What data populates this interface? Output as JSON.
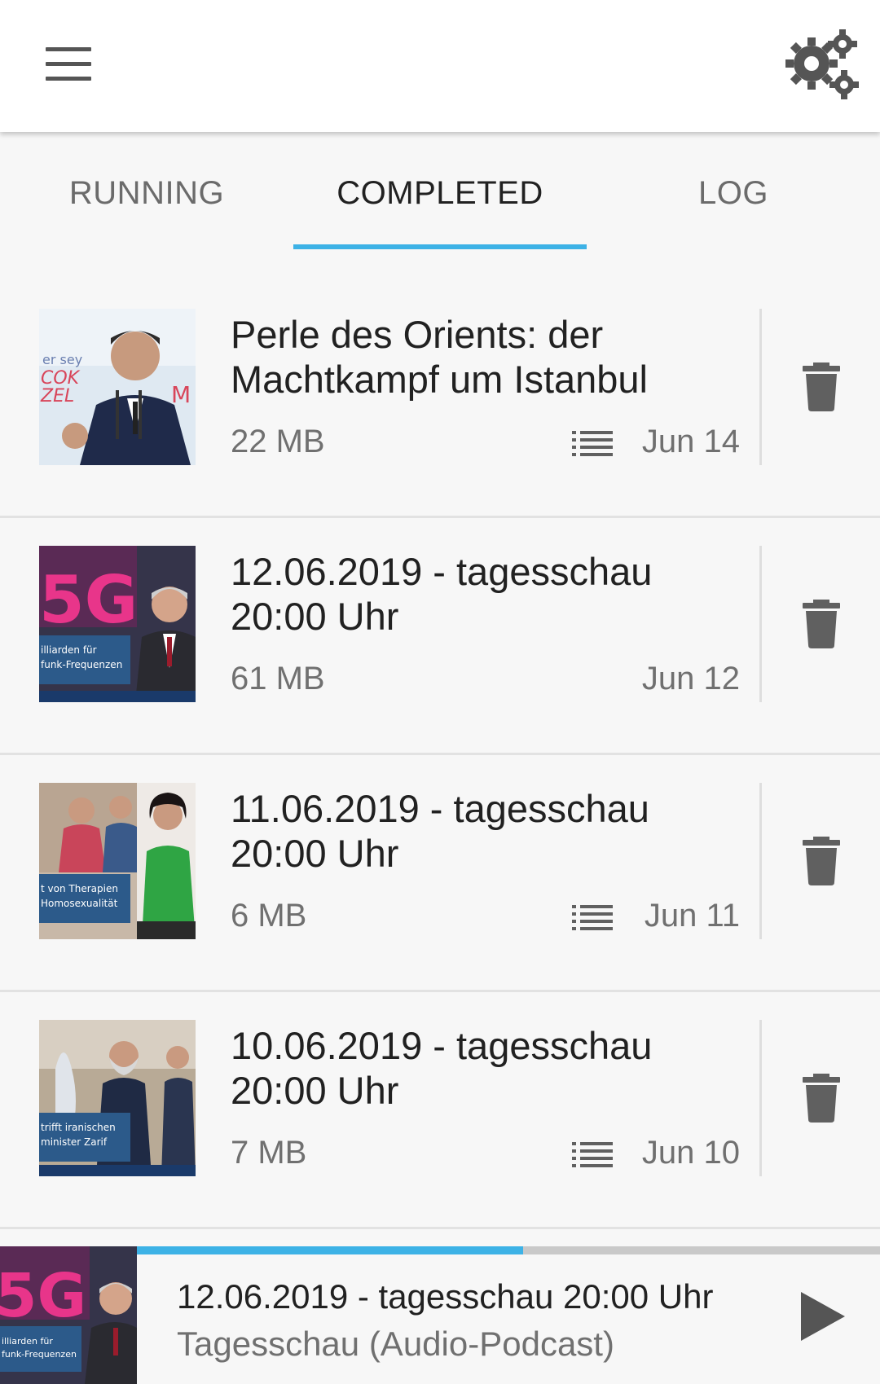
{
  "appbar": {
    "menu_icon": "hamburger-menu-icon",
    "settings_icon": "gears-icon"
  },
  "tabs": [
    {
      "label": "RUNNING",
      "active": false
    },
    {
      "label": "COMPLETED",
      "active": true
    },
    {
      "label": "LOG",
      "active": false
    }
  ],
  "colors": {
    "accent": "#3db2e6",
    "text": "#212121",
    "secondary": "#707070",
    "icon": "#555555"
  },
  "items": [
    {
      "title": "Perle des Orients: der Machtkampf um Istanbul",
      "size": "22 MB",
      "date": "Jun 14",
      "has_chapters": true
    },
    {
      "title": "12.06.2019 - tagesschau 20:00 Uhr",
      "size": "61 MB",
      "date": "Jun 12",
      "has_chapters": false
    },
    {
      "title": "11.06.2019 - tagesschau 20:00 Uhr",
      "size": "6 MB",
      "date": "Jun 11",
      "has_chapters": true
    },
    {
      "title": "10.06.2019 - tagesschau 20:00 Uhr",
      "size": "7 MB",
      "date": "Jun 10",
      "has_chapters": true
    }
  ],
  "player": {
    "title": "12.06.2019 - tagesschau 20:00 Uhr",
    "subtitle": "Tagesschau (Audio-Podcast)",
    "progress": 0.52
  }
}
